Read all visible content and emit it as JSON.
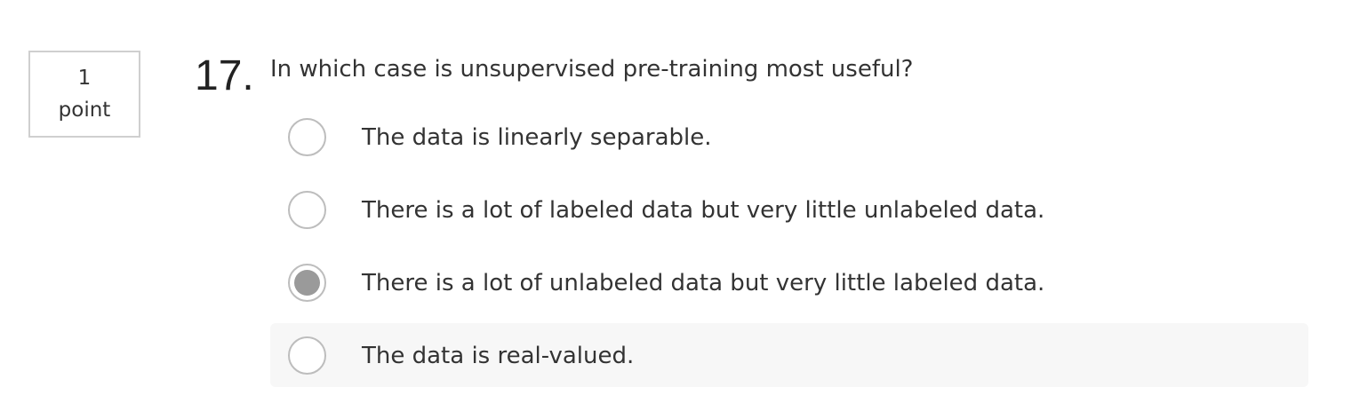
{
  "question": {
    "points_value": "1",
    "points_unit": "point",
    "number": "17.",
    "prompt": "In which case is unsupervised pre-training most useful?"
  },
  "options": [
    {
      "label": "The data is linearly separable.",
      "selected": false,
      "hovered": false
    },
    {
      "label": "There is a lot of labeled data but very little unlabeled data.",
      "selected": false,
      "hovered": false
    },
    {
      "label": "There is a lot of unlabeled data but very little labeled data.",
      "selected": true,
      "hovered": false
    },
    {
      "label": "The data is real-valued.",
      "selected": false,
      "hovered": true
    }
  ],
  "colors": {
    "radio_border": "#bdbdbd",
    "radio_fill_selected": "#9a9a9a",
    "hover_background": "#f7f7f7",
    "text": "#333333"
  }
}
